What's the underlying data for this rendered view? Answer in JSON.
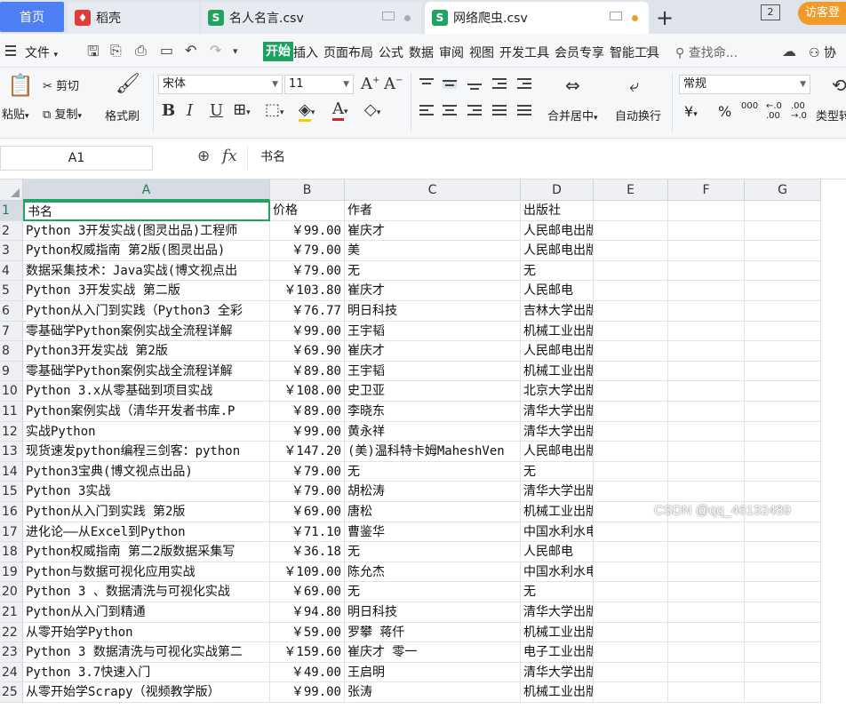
{
  "tabs": {
    "home": "首页",
    "doc": "稻壳",
    "file1": "名人名言.csv",
    "file2": "网络爬虫.csv",
    "file1_icon": "S",
    "file2_icon": "S",
    "window_count": "2",
    "visitor": "访客登"
  },
  "menu": {
    "file": "文件",
    "start": "开始",
    "items": [
      "插入",
      "页面布局",
      "公式",
      "数据",
      "审阅",
      "视图",
      "开发工具",
      "会员专享",
      "智能工具"
    ],
    "search": "查找命...",
    "collab": "协"
  },
  "ribbon": {
    "paste": "粘贴",
    "cut": "剪切",
    "copy": "复制",
    "format_painter": "格式刷",
    "font_name": "宋体",
    "font_size": "11",
    "merge_center": "合并居中",
    "wrap_text": "自动换行",
    "number_format": "常规",
    "currency": "¥",
    "percent": "%",
    "thousands": "000",
    "type_convert": "类型转"
  },
  "formula_bar": {
    "name_box": "A1",
    "fx": "fx",
    "content": "书名"
  },
  "columns": [
    "A",
    "B",
    "C",
    "D",
    "E",
    "F",
    "G"
  ],
  "rows": [
    {
      "n": "1",
      "a": "书名",
      "b": "价格",
      "c": "作者",
      "d": "出版社"
    },
    {
      "n": "2",
      "a": "Python 3开发实战(图灵出品)工程师",
      "b": "￥99.00",
      "c": "崔庆才",
      "d": "人民邮电出版社"
    },
    {
      "n": "3",
      "a": "Python权威指南 第2版(图灵出品)",
      "b": "￥79.00",
      "c": "美",
      "d": "人民邮电出版社"
    },
    {
      "n": "4",
      "a": "数据采集技术：Java实战(博文视点出",
      "b": "￥79.00",
      "c": "无",
      "d": "无"
    },
    {
      "n": "5",
      "a": "Python 3开发实战 第二版",
      "b": "￥103.80",
      "c": "崔庆才",
      "d": "人民邮电"
    },
    {
      "n": "6",
      "a": "Python从入门到实践（Python3 全彩",
      "b": "￥76.77",
      "c": "明日科技",
      "d": "吉林大学出版社"
    },
    {
      "n": "7",
      "a": "零基础学Python案例实战全流程详解",
      "b": "￥99.00",
      "c": "王宇韬",
      "d": "机械工业出版社"
    },
    {
      "n": "8",
      "a": "Python3开发实战 第2版",
      "b": "￥69.90",
      "c": "崔庆才",
      "d": "人民邮电出版社"
    },
    {
      "n": "9",
      "a": "零基础学Python案例实战全流程详解",
      "b": "￥89.80",
      "c": "王宇韬",
      "d": "机械工业出版社"
    },
    {
      "n": "10",
      "a": "Python 3.x从零基础到项目实战",
      "b": "￥108.00",
      "c": "史卫亚",
      "d": "北京大学出版社"
    },
    {
      "n": "11",
      "a": "Python案例实战（清华开发者书库.P",
      "b": "￥89.00",
      "c": "李晓东",
      "d": "清华大学出版社"
    },
    {
      "n": "12",
      "a": "实战Python",
      "b": "￥99.00",
      "c": "黄永祥",
      "d": "清华大学出版社"
    },
    {
      "n": "13",
      "a": "现货速发python编程三剑客：python",
      "b": "￥147.20",
      "c": "(美)温科特卡姆MaheshVen",
      "d": "人民邮电出版社"
    },
    {
      "n": "14",
      "a": "Python3宝典(博文视点出品)",
      "b": "￥79.00",
      "c": "无",
      "d": "无"
    },
    {
      "n": "15",
      "a": "Python 3实战",
      "b": "￥79.00",
      "c": "胡松涛",
      "d": "清华大学出版社"
    },
    {
      "n": "16",
      "a": "Python从入门到实践 第2版",
      "b": "￥69.00",
      "c": "唐松",
      "d": "机械工业出版社"
    },
    {
      "n": "17",
      "a": "进化论——从Excel到Python",
      "b": "￥71.10",
      "c": "曹鉴华",
      "d": "中国水利水电出版社"
    },
    {
      "n": "18",
      "a": "Python权威指南 第二2版数据采集写",
      "b": "￥36.18",
      "c": "无",
      "d": "人民邮电"
    },
    {
      "n": "19",
      "a": "Python与数据可视化应用实战",
      "b": "￥109.00",
      "c": "陈允杰",
      "d": "中国水利水电出版社"
    },
    {
      "n": "20",
      "a": "Python 3 、数据清洗与可视化实战",
      "b": "￥69.00",
      "c": "无",
      "d": "无"
    },
    {
      "n": "21",
      "a": "Python从入门到精通",
      "b": "￥94.80",
      "c": "明日科技",
      "d": "清华大学出版社"
    },
    {
      "n": "22",
      "a": "从零开始学Python",
      "b": "￥59.00",
      "c": "罗攀 蒋仟",
      "d": "机械工业出版社"
    },
    {
      "n": "23",
      "a": "Python 3 数据清洗与可视化实战第二",
      "b": "￥159.60",
      "c": "崔庆才 零一",
      "d": "电子工业出版社"
    },
    {
      "n": "24",
      "a": "Python 3.7快速入门",
      "b": "￥49.00",
      "c": "王启明",
      "d": "清华大学出版社"
    },
    {
      "n": "25",
      "a": "从零开始学Scrapy（视频教学版）",
      "b": "￥99.00",
      "c": "张涛",
      "d": "机械工业出版社"
    }
  ],
  "watermark": "CSDN @qq_46132489"
}
